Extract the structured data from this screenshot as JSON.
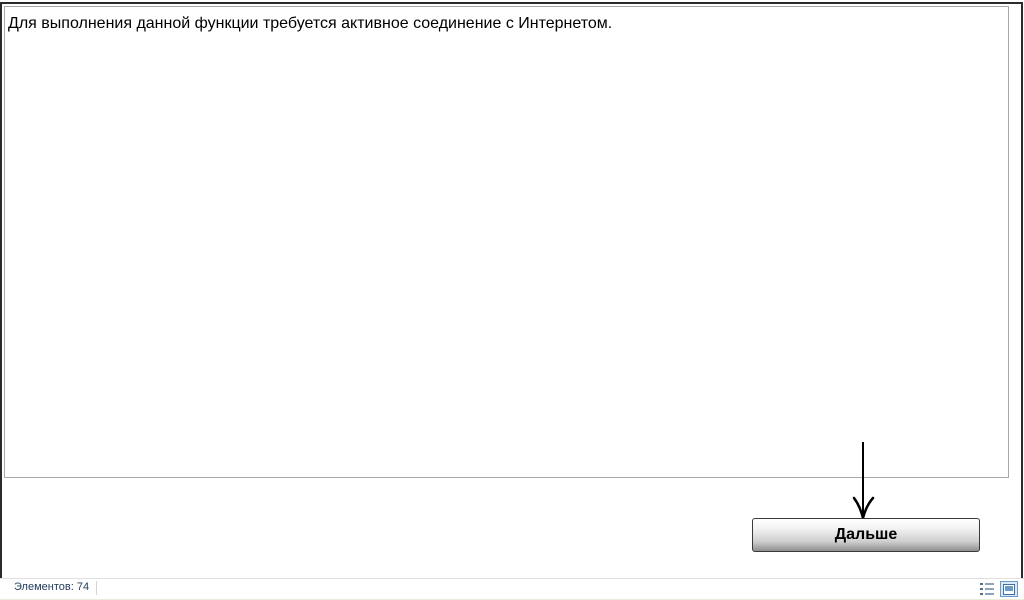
{
  "dialog": {
    "message": "Для выполнения данной функции требуется активное соединение с Интернетом.",
    "next_label": "Дальше"
  },
  "statusbar": {
    "items_count": "Элементов: 74"
  },
  "icons": {
    "arrow": "down-arrow-icon",
    "details_view": "details-view-icon",
    "preview_view": "preview-view-icon"
  },
  "colors": {
    "window_border": "#2b2b2b",
    "status_text": "#1f3a5a",
    "active_view_bg": "#dbe9f7"
  }
}
